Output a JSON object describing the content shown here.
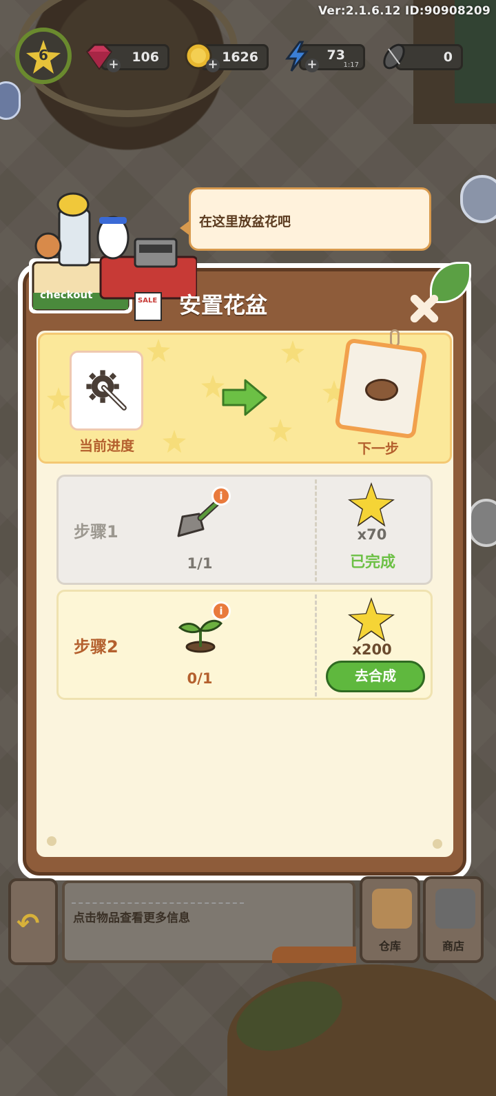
{
  "version_text": "Ver:2.1.6.12 ID:90908209",
  "hud": {
    "level": "6",
    "gems": "106",
    "coins": "1626",
    "energy": "73",
    "energy_timer": "1:17",
    "seeds": "0",
    "plus_glyph": "+"
  },
  "tutorial_bubble": "在这里放盆花吧",
  "dialog": {
    "title": "安置花盆",
    "current_progress_label": "当前进度",
    "next_step_label": "下一步",
    "steps": [
      {
        "name": "步骤1",
        "count": "1/1",
        "reward": "x70",
        "status": "已完成",
        "item_icon": "trowel-icon"
      },
      {
        "name": "步骤2",
        "count": "0/1",
        "reward": "x200",
        "action": "去合成",
        "item_icon": "sprout-icon"
      }
    ],
    "info_glyph": "i"
  },
  "bottom_bar": {
    "hint": "点击物品查看更多信息",
    "warehouse": "仓库",
    "shop": "商店"
  },
  "shop_sign": "checkout",
  "sale_sign": "SALE",
  "colors": {
    "accent_orange": "#b4602e",
    "done_green": "#6cc045",
    "button_green": "#5fb83e",
    "dialog_brown": "#8e5c3a",
    "panel_cream": "#fbf4dd"
  }
}
